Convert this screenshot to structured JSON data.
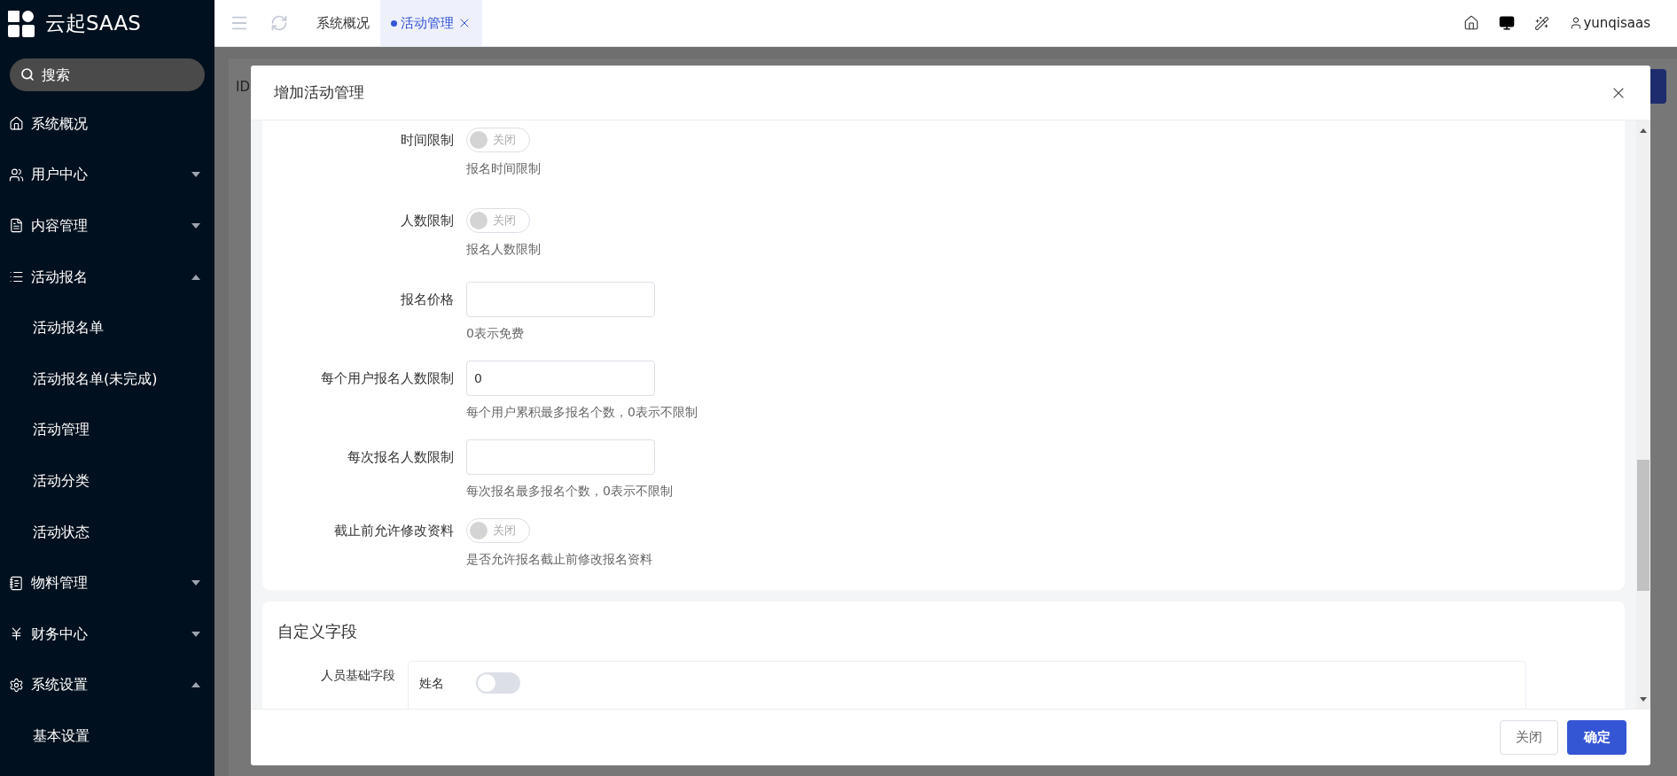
{
  "sidebar": {
    "logo_text": "云起SAAS",
    "search": {
      "placeholder": "搜索"
    },
    "items": [
      {
        "label": "系统概况",
        "kind": "link"
      },
      {
        "label": "用户中心",
        "kind": "group",
        "expanded": false
      },
      {
        "label": "内容管理",
        "kind": "group",
        "expanded": false
      },
      {
        "label": "活动报名",
        "kind": "group",
        "expanded": true,
        "children": [
          {
            "label": "活动报名单"
          },
          {
            "label": "活动报名单(未完成)"
          },
          {
            "label": "活动管理"
          },
          {
            "label": "活动分类"
          },
          {
            "label": "活动状态"
          }
        ]
      },
      {
        "label": "物料管理",
        "kind": "group",
        "expanded": false
      },
      {
        "label": "财务中心",
        "kind": "group",
        "expanded": false
      },
      {
        "label": "系统设置",
        "kind": "group",
        "expanded": true,
        "children": [
          {
            "label": "基本设置"
          }
        ]
      }
    ]
  },
  "top_bar": {
    "tabs": [
      {
        "label": "系统概况",
        "selected": false
      },
      {
        "label": "活动管理",
        "selected": true
      }
    ],
    "user": "yunqisaas"
  },
  "background": {
    "column_1": "ID"
  },
  "dialog": {
    "title": "增加活动管理",
    "fields": [
      {
        "kind": "switch",
        "label": "时间限制",
        "switch_text": "关闭",
        "on": false,
        "hint": "报名时间限制"
      },
      {
        "kind": "switch",
        "label": "人数限制",
        "switch_text": "关闭",
        "on": false,
        "hint": "报名人数限制"
      },
      {
        "kind": "input",
        "label": "报名价格",
        "hint": "0表示免费"
      },
      {
        "kind": "input",
        "label": "每个用户报名人数限制",
        "value": "0",
        "hint": "每个用户累积最多报名个数，0表示不限制"
      },
      {
        "kind": "input",
        "label": "每次报名人数限制",
        "hint": "每次报名最多报名个数，0表示不限制"
      },
      {
        "kind": "switch",
        "label": "截止前允许修改资料",
        "switch_text": "关闭",
        "on": false,
        "hint": "是否允许报名截止前修改报名资料"
      }
    ],
    "custom_section": {
      "title": "自定义字段",
      "label": "人员基础字段",
      "fields": [
        {
          "name": "姓名",
          "on": false
        }
      ]
    },
    "buttons": {
      "cancel": "关闭",
      "confirm": "确定"
    }
  }
}
